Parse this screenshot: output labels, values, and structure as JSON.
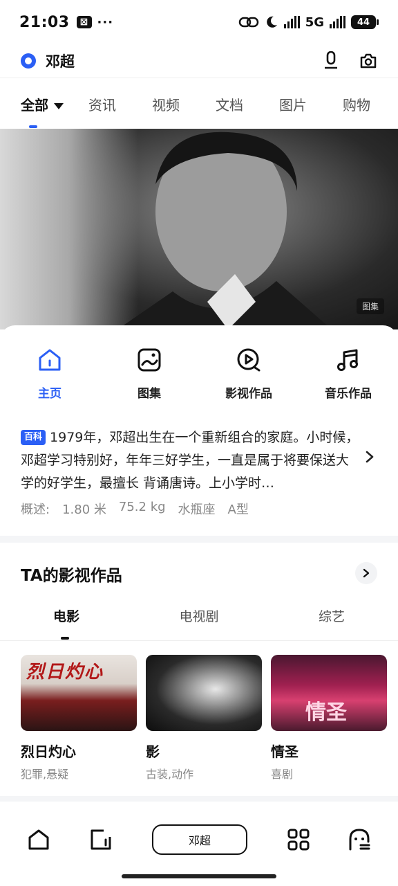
{
  "status_bar": {
    "time": "21:03",
    "app_glyph": "⊠",
    "dots": "···",
    "network": "5G",
    "battery": "44"
  },
  "search": {
    "query": "邓超"
  },
  "tabs": [
    {
      "label": "全部",
      "active": true
    },
    {
      "label": "资讯"
    },
    {
      "label": "视频"
    },
    {
      "label": "文档"
    },
    {
      "label": "图片"
    },
    {
      "label": "购物"
    }
  ],
  "hero": {
    "gallery_tag": "图集"
  },
  "quick_actions": [
    {
      "label": "主页",
      "icon": "home-icon",
      "active": true
    },
    {
      "label": "图集",
      "icon": "gallery-icon"
    },
    {
      "label": "影视作品",
      "icon": "play-icon"
    },
    {
      "label": "音乐作品",
      "icon": "music-icon"
    }
  ],
  "bio": {
    "tag": "百科",
    "text": "1979年，邓超出生在一个重新组合的家庭。小时候，邓超学习特别好，年年三好学生，一直是属于将要保送大学的好学生，最擅长 背诵唐诗。上小学时…",
    "facts": [
      "概述:",
      "1.80 米",
      "75.2 kg",
      "水瓶座",
      "A型"
    ]
  },
  "works": {
    "title": "TA的影视作品",
    "sub_tabs": [
      {
        "label": "电影",
        "active": true
      },
      {
        "label": "电视剧"
      },
      {
        "label": "综艺"
      }
    ],
    "cards": [
      {
        "name": "烈日灼心",
        "genre": "犯罪,悬疑",
        "poster_text": "烈日灼心"
      },
      {
        "name": "影",
        "genre": "古装,动作"
      },
      {
        "name": "情圣",
        "genre": "喜剧",
        "poster_text": "情圣"
      }
    ]
  },
  "bottom_nav": {
    "search_label": "邓超"
  },
  "colors": {
    "accent": "#2b5ff5",
    "text": "#111111",
    "muted": "#888888"
  }
}
